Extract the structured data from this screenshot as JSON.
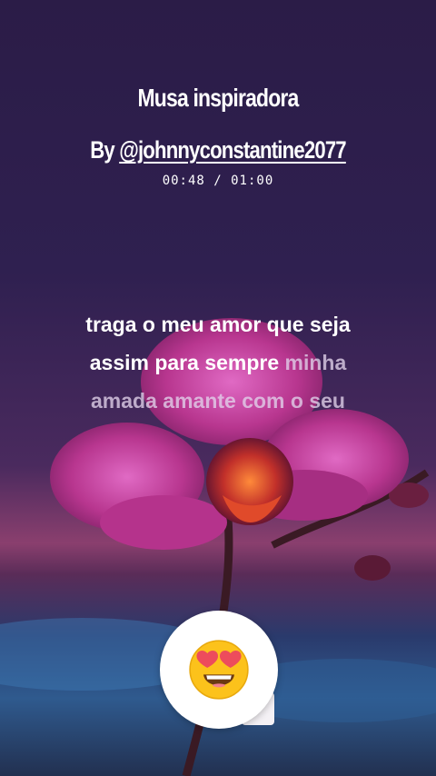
{
  "video": {
    "title": "Musa inspiradora",
    "byline_prefix": "By ",
    "author_handle": "@johnnyconstantine2077",
    "timer": "00:48 / 01:00"
  },
  "lyrics": {
    "line1": "traga o meu amor  que seja",
    "line2_active": "assim para sempre ",
    "line2_dim": " minha",
    "line3": "amada amante  com o seu"
  },
  "reaction": {
    "icon": "heart-eyes-emoji-icon"
  },
  "colors": {
    "background_top": "#281b45",
    "background_mid": "#3e2457",
    "flower": "#c0399a",
    "text": "#ffffff",
    "text_dim": "#d9c7e4"
  }
}
